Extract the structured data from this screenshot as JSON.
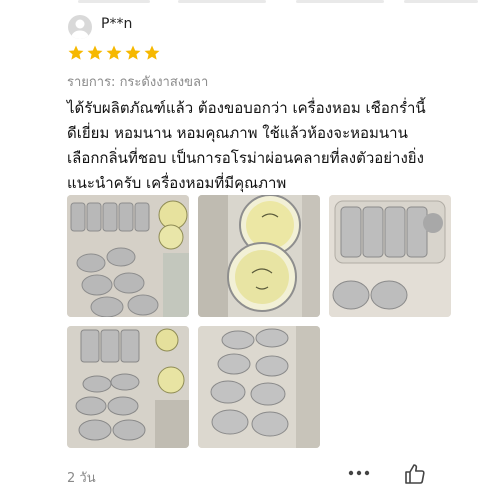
{
  "review": {
    "username": "P**n",
    "rating": 5,
    "variation": "รายการ: กระดังงาสงขลา",
    "text": "ได้รับผลิตภัณฑ์แล้ว ต้องขอบอกว่า เครื่องหอม เชือกร่ำนี้\nดีเยี่ยม หอมนาน หอมคุณภาพ ใช้แล้วห้องจะหอมนาน\nเลือกกลิ่นที่ชอบ เป็นการอโรม่าผ่อนคลายที่ลงตัวอย่างยิ่ง\nแนะนำครับ เครื่องหอมที่มีคุณภาพ",
    "time_ago": "2 วัน",
    "photos": 5
  },
  "colors": {
    "star": "#f6b800",
    "muted_text": "#8a8a8a",
    "avatar_bg": "#d9d9d9",
    "icon": "#444444"
  },
  "icons": {
    "avatar": "user-avatar-icon",
    "star": "star-icon",
    "more": "more-options-icon",
    "like": "thumbs-up-icon"
  }
}
